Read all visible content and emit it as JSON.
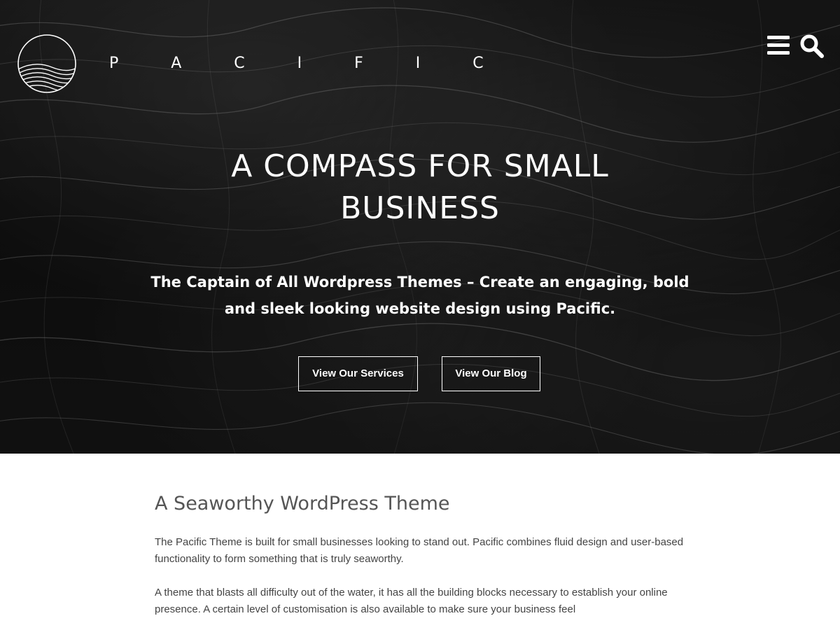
{
  "header": {
    "logo_icon": "pacific-logo-icon",
    "brand_name": "P A C I F I C",
    "menu_icon": "hamburger-menu-icon",
    "search_icon": "search-icon"
  },
  "hero": {
    "title": "A COMPASS FOR SMALL BUSINESS",
    "subtitle": "The Captain of All Wordpress Themes – Create an engaging, bold and sleek looking website design using Pacific.",
    "buttons": [
      {
        "label": "View Our Services"
      },
      {
        "label": "View Our Blog"
      }
    ]
  },
  "content": {
    "title": "A Seaworthy WordPress Theme",
    "paragraphs": [
      "The Pacific Theme is built for small businesses looking to stand out. Pacific combines fluid design and user-based functionality to form something that is truly seaworthy.",
      "A theme that blasts all difficulty out of the water, it has all the building blocks necessary to establish your online presence. A certain level of customisation is also available to make sure your business feel"
    ]
  },
  "colors": {
    "hero_background": "#121212",
    "hero_text": "#ffffff",
    "content_heading": "#555555",
    "content_text": "#444444"
  }
}
